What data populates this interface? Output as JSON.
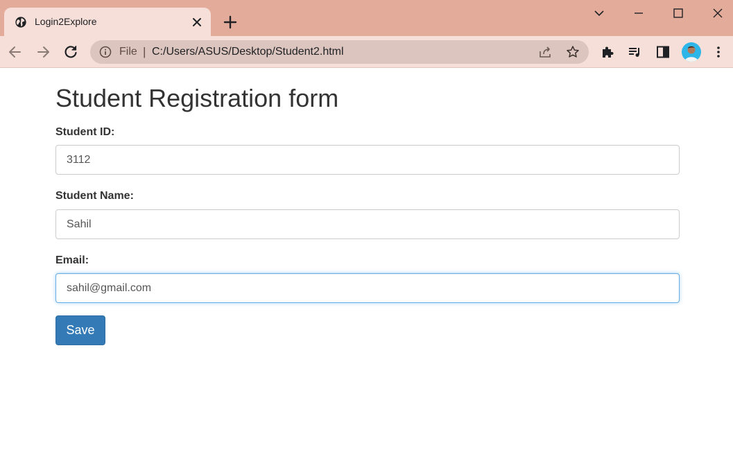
{
  "browser": {
    "tab": {
      "title": "Login2Explore"
    },
    "omnibox": {
      "scheme": "File",
      "url": "C:/Users/ASUS/Desktop/Student2.html"
    },
    "colors": {
      "titlebar": "#e3ab9a",
      "tab_active": "#f5dfd8",
      "omnibox": "#dcc5be"
    }
  },
  "form": {
    "title": "Student Registration form",
    "fields": [
      {
        "label": "Student ID:",
        "value": "3112"
      },
      {
        "label": "Student Name:",
        "value": "Sahil"
      },
      {
        "label": "Email:",
        "value": "sahil@gmail.com"
      }
    ],
    "save_label": "Save",
    "colors": {
      "primary": "#337ab7",
      "focus": "#66afe9"
    }
  }
}
